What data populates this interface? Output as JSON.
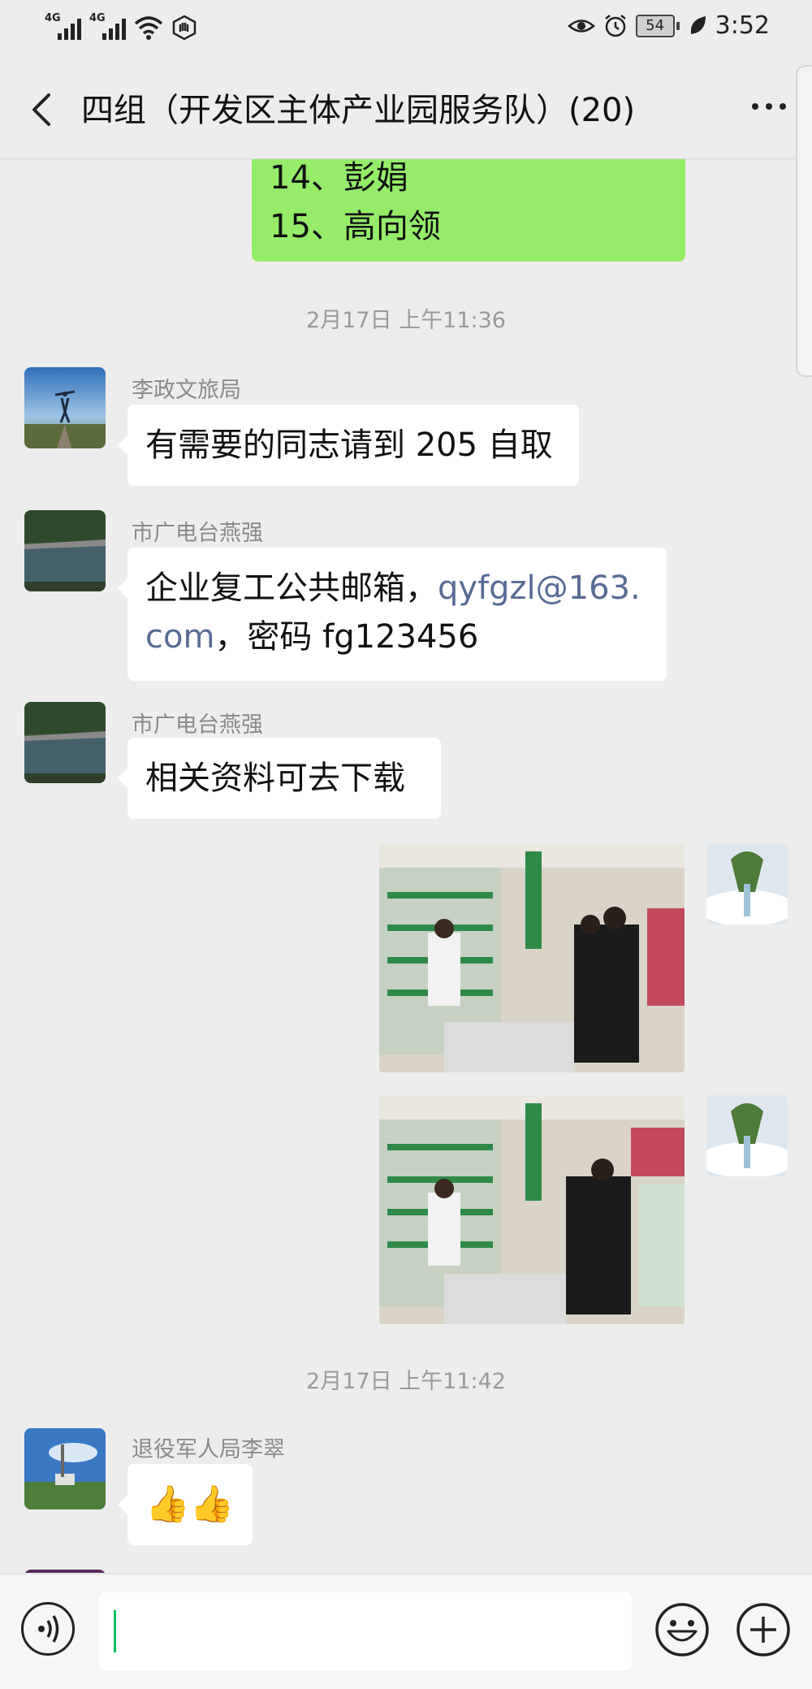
{
  "status": {
    "network1": "4G",
    "network2": "4G",
    "battery": "54",
    "time": "3:52"
  },
  "header": {
    "title": "四组（开发区主体产业园服务队）(20)"
  },
  "messages": {
    "continued": {
      "line1": "14、彭娟",
      "line2": "15、高向领"
    },
    "time1": "2月17日 上午11:36",
    "m1": {
      "sender": "李政文旅局",
      "text": "有需要的同志请到 205 自取"
    },
    "m2": {
      "sender": "市广电台燕强",
      "text_before": "企业复工公共邮箱，",
      "link1": "qyfgzl@163.",
      "link2": "com",
      "text_after": "，密码 fg123456"
    },
    "m3": {
      "sender": "市广电台燕强",
      "text": "相关资料可去下载"
    },
    "time2": "2月17日 上午11:42",
    "m6": {
      "sender": "退役军人局李翠",
      "text": "👍👍"
    }
  },
  "icons": {
    "back": "back-arrow-icon",
    "more": "more-dots-icon",
    "voice": "voice-icon",
    "emoji": "emoji-icon",
    "plus": "plus-icon"
  },
  "colors": {
    "own_bubble": "#95ec69",
    "link": "#576b95",
    "caret": "#07c160"
  }
}
